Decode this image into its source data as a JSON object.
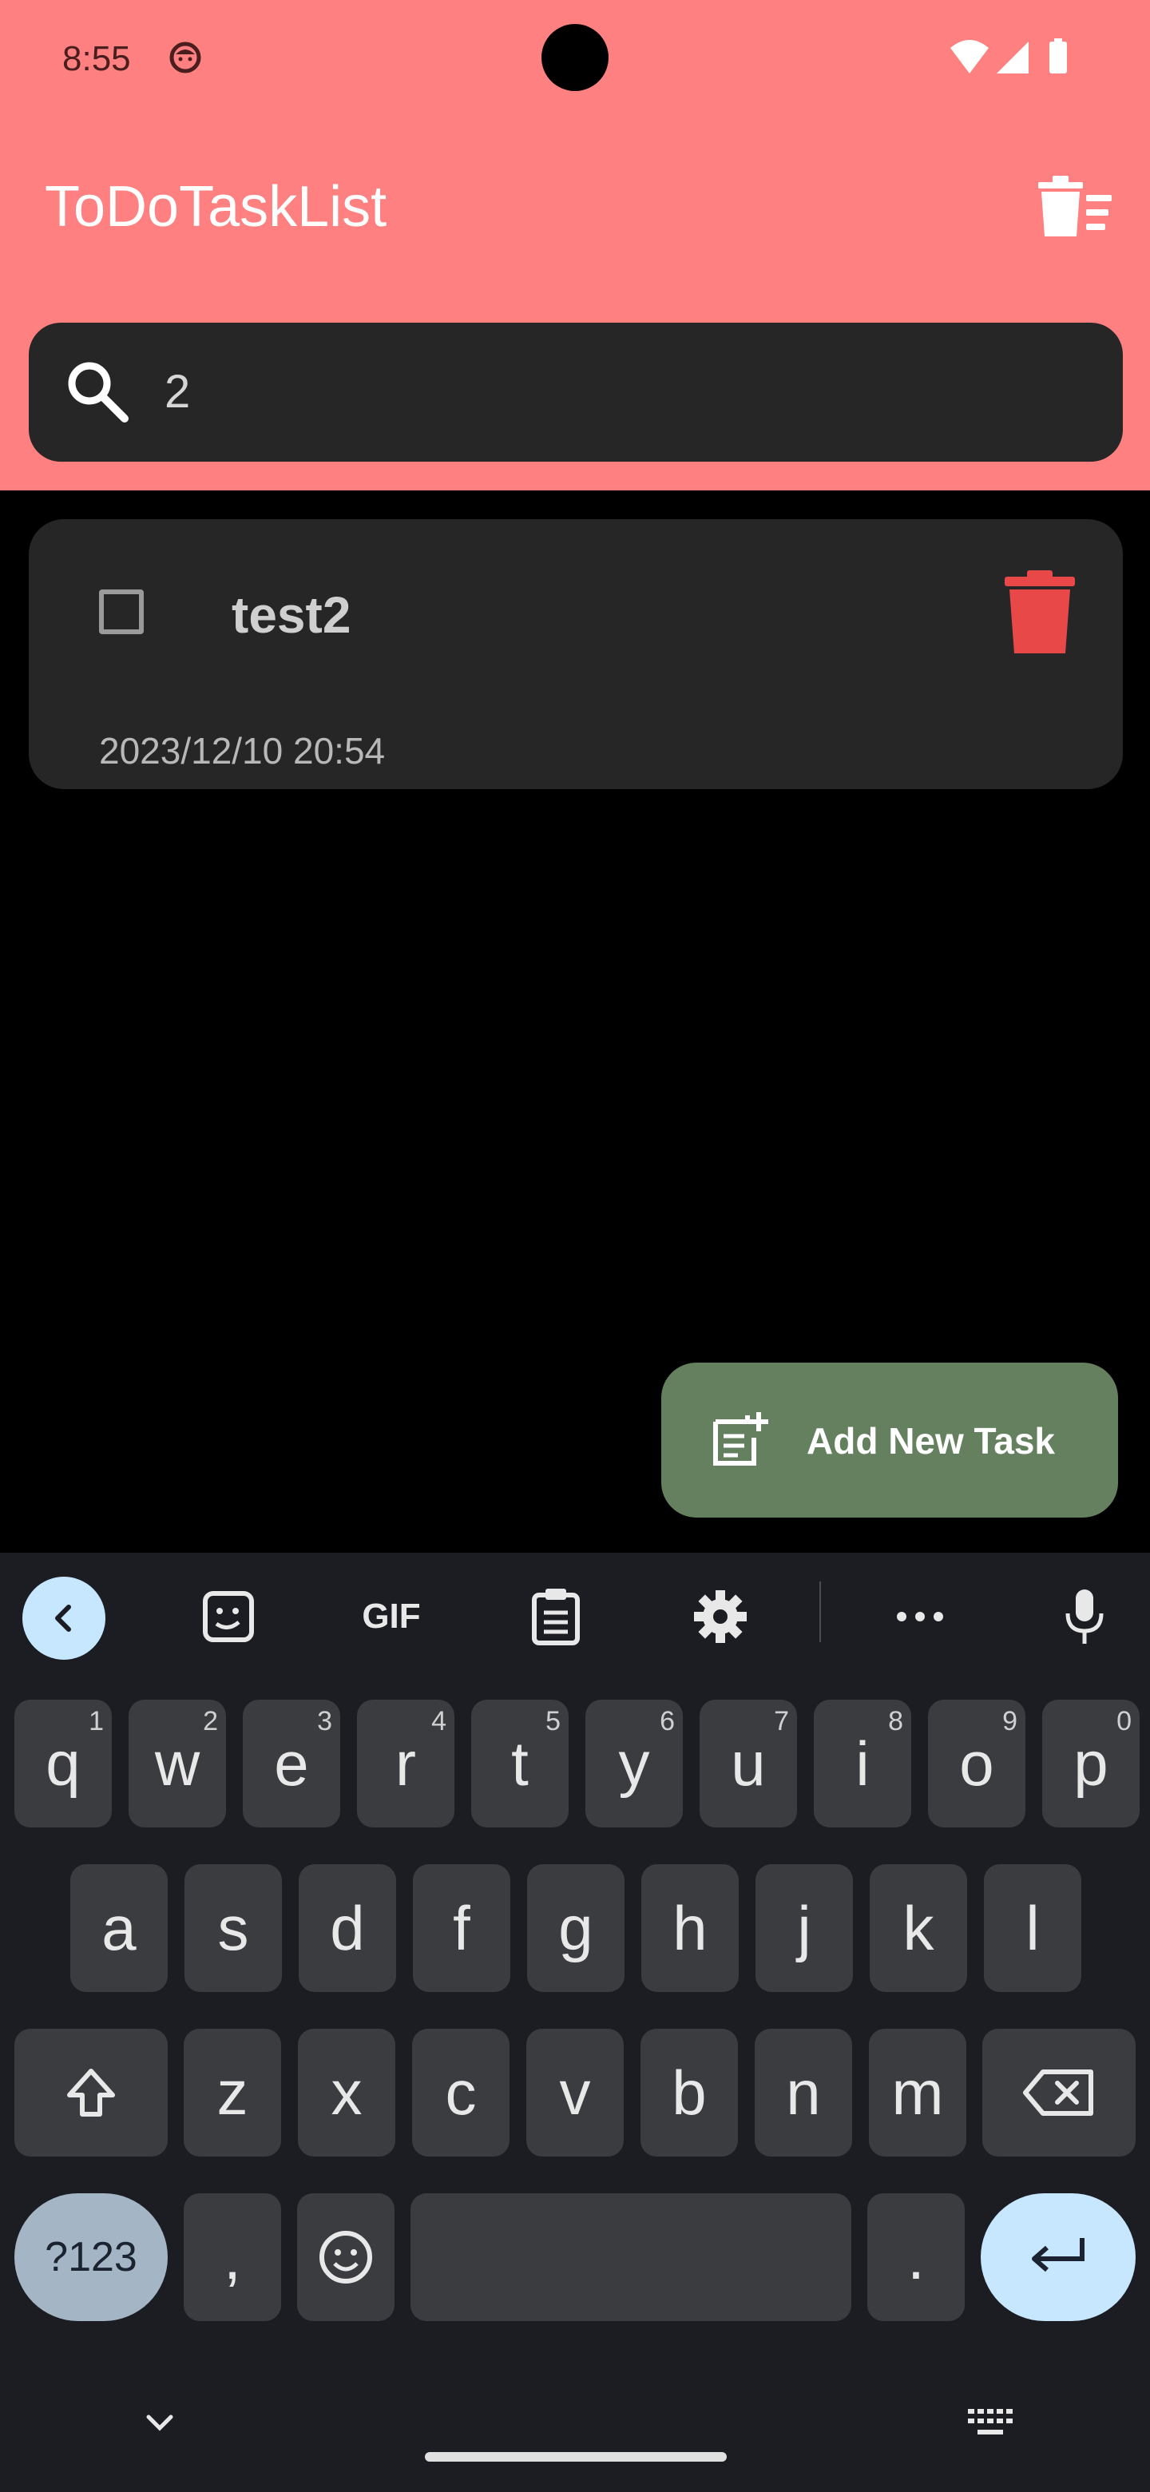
{
  "status": {
    "time": "8:55"
  },
  "app": {
    "title": "ToDoTaskList"
  },
  "search": {
    "value": "2",
    "placeholder": ""
  },
  "tasks": [
    {
      "title": "test2",
      "date": "2023/12/10 20:54",
      "checked": false
    }
  ],
  "fab": {
    "label": "Add New Task"
  },
  "keyboard": {
    "row1": [
      {
        "k": "q",
        "n": "1"
      },
      {
        "k": "w",
        "n": "2"
      },
      {
        "k": "e",
        "n": "3"
      },
      {
        "k": "r",
        "n": "4"
      },
      {
        "k": "t",
        "n": "5"
      },
      {
        "k": "y",
        "n": "6"
      },
      {
        "k": "u",
        "n": "7"
      },
      {
        "k": "i",
        "n": "8"
      },
      {
        "k": "o",
        "n": "9"
      },
      {
        "k": "p",
        "n": "0"
      }
    ],
    "row2": [
      "a",
      "s",
      "d",
      "f",
      "g",
      "h",
      "j",
      "k",
      "l"
    ],
    "row3": [
      "z",
      "x",
      "c",
      "v",
      "b",
      "n",
      "m"
    ],
    "symbols_label": "?123",
    "comma": ",",
    "period": ".",
    "toolbar": {
      "gif_label": "GIF"
    }
  },
  "colors": {
    "appbar": "#ff8080",
    "delete": "#e84848",
    "fab": "#65805f",
    "keyboard_bg": "#1b1d22"
  }
}
